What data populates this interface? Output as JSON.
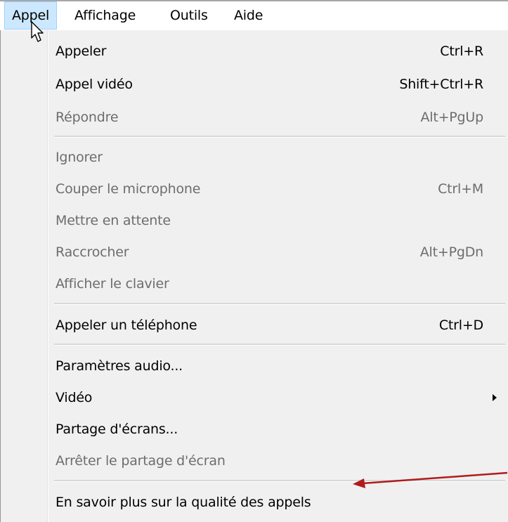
{
  "menubar": {
    "items": [
      {
        "label": "Appel",
        "active": true
      },
      {
        "label": "Affichage",
        "active": false
      },
      {
        "label": "Outils",
        "active": false
      },
      {
        "label": "Aide",
        "active": false
      }
    ]
  },
  "menu": {
    "items": [
      {
        "label": "Appeler",
        "shortcut": "Ctrl+R",
        "enabled": true
      },
      {
        "label": "Appel vidéo",
        "shortcut": "Shift+Ctrl+R",
        "enabled": true
      },
      {
        "label": "Répondre",
        "shortcut": "Alt+PgUp",
        "enabled": false
      },
      {
        "label": "Ignorer",
        "shortcut": "",
        "enabled": false
      },
      {
        "label": "Couper le microphone",
        "shortcut": "Ctrl+M",
        "enabled": false
      },
      {
        "label": "Mettre en attente",
        "shortcut": "",
        "enabled": false
      },
      {
        "label": "Raccrocher",
        "shortcut": "Alt+PgDn",
        "enabled": false
      },
      {
        "label": "Afficher le clavier",
        "shortcut": "",
        "enabled": false
      },
      {
        "label": "Appeler un téléphone",
        "shortcut": "Ctrl+D",
        "enabled": true
      },
      {
        "label": "Paramètres audio...",
        "shortcut": "",
        "enabled": true
      },
      {
        "label": "Vidéo",
        "shortcut": "",
        "enabled": true,
        "submenu": true
      },
      {
        "label": "Partage d'écrans...",
        "shortcut": "",
        "enabled": true
      },
      {
        "label": "Arrêter le partage d'écran",
        "shortcut": "",
        "enabled": false
      },
      {
        "label": "En savoir plus sur la qualité des appels",
        "shortcut": "",
        "enabled": true
      }
    ]
  },
  "colors": {
    "menu_background": "#f0f0f0",
    "active_menubar_highlight": "#cce8ff",
    "disabled_text": "#6d6d6d",
    "annotation_arrow": "#b01c1c"
  },
  "icons": {
    "cursor": "mouse-pointer-icon",
    "submenu": "submenu-arrow-icon",
    "annotation": "red-arrow-annotation"
  }
}
